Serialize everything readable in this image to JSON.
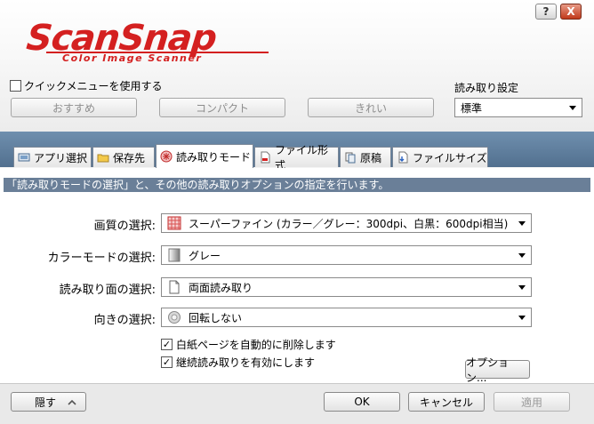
{
  "titlebar": {
    "help_label": "?",
    "close_label": "X"
  },
  "logo": {
    "wordmark": "ScanSnap",
    "tagline": "Color Image Scanner"
  },
  "quick_menu": {
    "label": "クイックメニューを使用する",
    "checked": false
  },
  "mode_buttons": [
    "おすすめ",
    "コンパクト",
    "きれい"
  ],
  "scan_setting": {
    "label": "読み取り設定",
    "value": "標準"
  },
  "tabs": [
    {
      "label": "アプリ選択",
      "icon": "app-select-icon",
      "active": false
    },
    {
      "label": "保存先",
      "icon": "folder-icon",
      "active": false
    },
    {
      "label": "読み取りモード",
      "icon": "scan-mode-icon",
      "active": true
    },
    {
      "label": "ファイル形式",
      "icon": "file-format-icon",
      "active": false
    },
    {
      "label": "原稿",
      "icon": "paper-icon",
      "active": false
    },
    {
      "label": "ファイルサイズ",
      "icon": "file-size-icon",
      "active": false
    }
  ],
  "description": "「読み取りモードの選択」と、その他の読み取りオプションの指定を行います。",
  "fields": {
    "quality": {
      "label": "画質の選択:",
      "value": "スーパーファイン (カラー／グレー：300dpi、白黒：600dpi相当)",
      "icon": "quality-icon"
    },
    "color": {
      "label": "カラーモードの選択:",
      "value": "グレー",
      "icon": "gray-mode-icon"
    },
    "side": {
      "label": "読み取り面の選択:",
      "value": "両面読み取り",
      "icon": "duplex-icon"
    },
    "rotation": {
      "label": "向きの選択:",
      "value": "回転しない",
      "icon": "rotation-icon"
    }
  },
  "checkboxes": [
    {
      "label": "白紙ページを自動的に削除します",
      "checked": true
    },
    {
      "label": "継続読み取りを有効にします",
      "checked": true
    }
  ],
  "options_button": "オプション...",
  "footer": {
    "hide": "隠す",
    "ok": "OK",
    "cancel": "キャンセル",
    "apply": "適用"
  },
  "colors": {
    "logo_red": "#d42020",
    "tab_band": "#5f7d9c",
    "description_bg": "#6a7f98"
  }
}
